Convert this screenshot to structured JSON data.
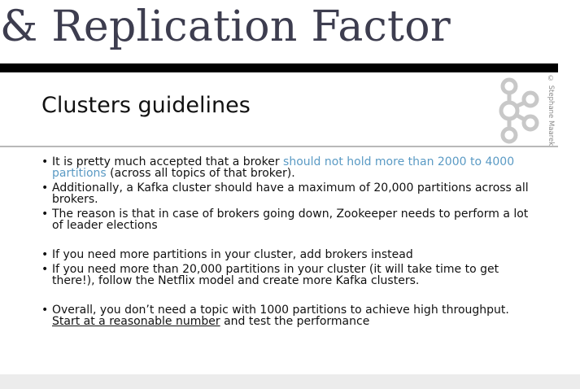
{
  "page": {
    "heading": "& Replication Factor"
  },
  "slide": {
    "title": "Clusters guidelines",
    "copyright": "© Stephane Maarek",
    "logo_icon": "kafka-logo-icon",
    "colors": {
      "accent": "#5a9ac4",
      "top_bar": "#000000",
      "rule": "#b9b9b9",
      "logo": "#c8c8c8"
    },
    "bullets": [
      {
        "pre": "It is pretty much accepted that a broker ",
        "accent": "should not hold more than 2000 to 4000 partitions",
        "post": " (across all topics of that broker)."
      },
      {
        "text": "Additionally, a Kafka cluster should have a maximum of 20,000 partitions across all brokers."
      },
      {
        "text": "The reason is that in case of brokers going down, Zookeeper needs to perform a lot of leader elections"
      },
      {
        "text": "If you need more partitions in your cluster, add brokers instead"
      },
      {
        "text": "If you need more than 20,000 partitions in your cluster (it will take time to get there!), follow the Netflix model and create more Kafka clusters."
      },
      {
        "pre": "Overall, you don’t need a topic with 1000 partitions to achieve high throughput. ",
        "underlined": "Start at a reasonable number",
        "post": " and test the performance"
      }
    ]
  }
}
